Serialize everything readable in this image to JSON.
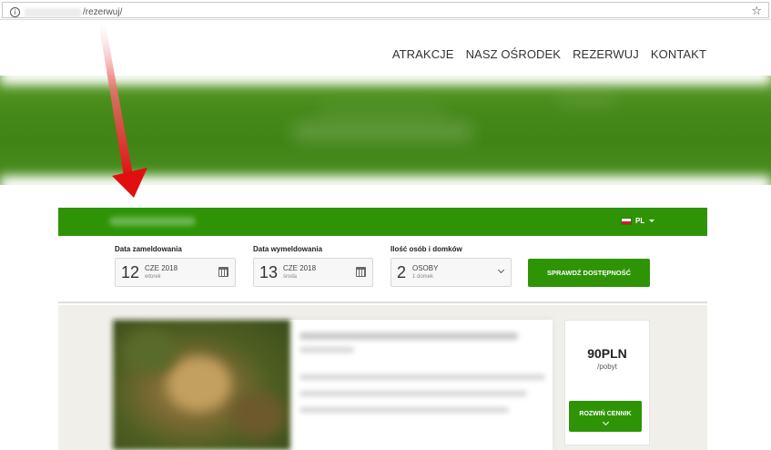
{
  "browser": {
    "url_path": "/rezerwuj/"
  },
  "nav": {
    "items": [
      {
        "label": "ATRAKCJE"
      },
      {
        "label": "NASZ OŚRODEK"
      },
      {
        "label": "REZERWUJ"
      },
      {
        "label": "KONTAKT"
      }
    ]
  },
  "booking": {
    "language": "PL",
    "checkin": {
      "label": "Data zameldowania",
      "day": "12",
      "month_year": "CZE 2018",
      "weekday": "wtorek"
    },
    "checkout": {
      "label": "Data wymeldowania",
      "day": "13",
      "month_year": "CZE 2018",
      "weekday": "środa"
    },
    "guests": {
      "label": "Ilość osób i domków",
      "count": "2",
      "unit": "OSOBY",
      "sub": "1 domek"
    },
    "check_button": "SPRAWDŹ DOSTĘPNOŚĆ"
  },
  "offer": {
    "price": "90PLN",
    "per": "/pobyt",
    "expand_button": "ROZWIŃ CENNIK"
  },
  "colors": {
    "brand_green": "#2e9406",
    "annotation_arrow": "#e01010"
  },
  "icons": [
    "info-icon",
    "star-icon",
    "flag-pl-icon",
    "calendar-icon",
    "chevron-down-icon",
    "red-arrow-annotation"
  ]
}
